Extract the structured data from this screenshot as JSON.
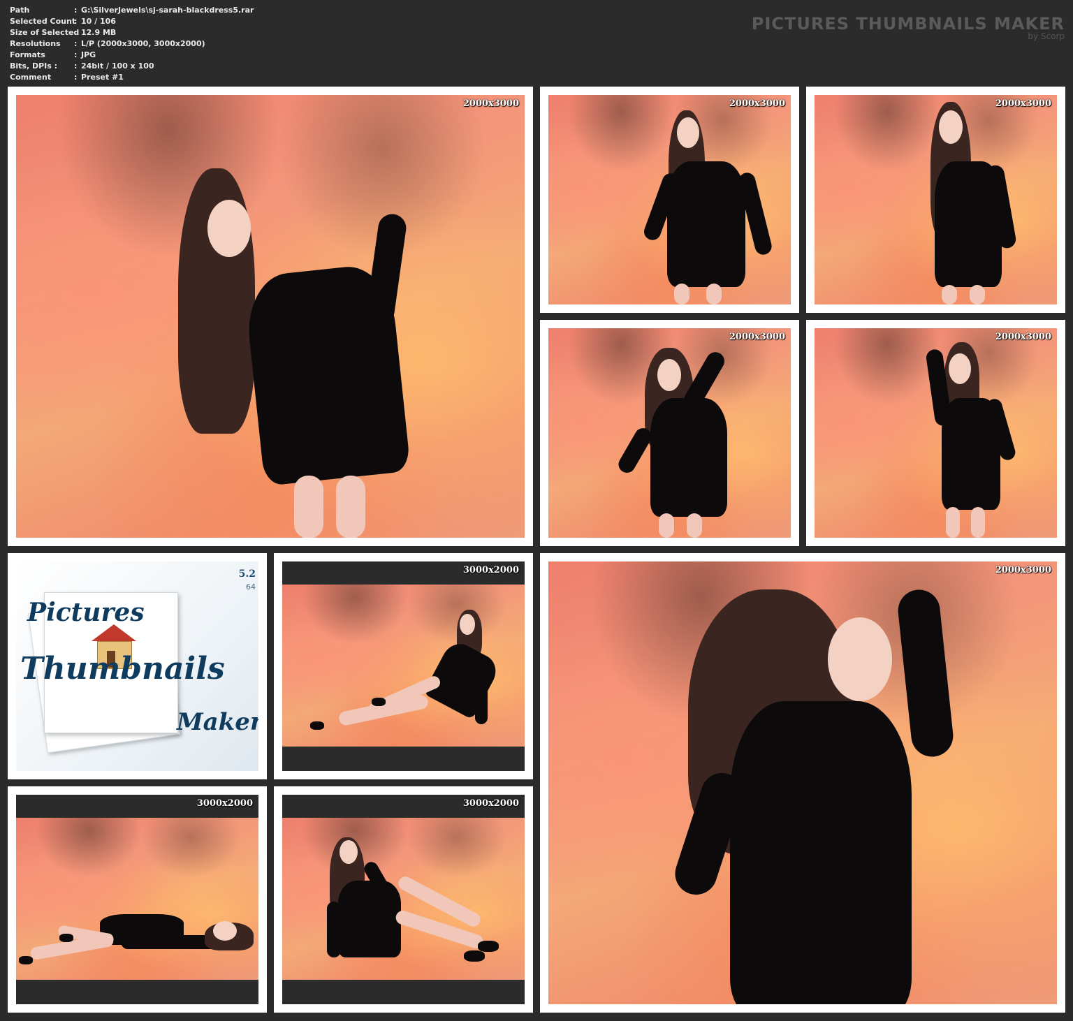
{
  "info": {
    "rows": [
      {
        "key": "Path",
        "sep": ":",
        "value": "G:\\SilverJewels\\sj-sarah-blackdress5.rar"
      },
      {
        "key": "Selected Count",
        "sep": ":",
        "value": "10 / 106"
      },
      {
        "key": "Size of Selected",
        "sep": ":",
        "value": "12.9 MB"
      },
      {
        "key": "Resolutions",
        "sep": ":",
        "value": "L/P (2000x3000, 3000x2000)"
      },
      {
        "key": "Formats",
        "sep": ":",
        "value": "JPG"
      },
      {
        "key": "Bits, DPIs :",
        "sep": ":",
        "value": "24bit / 100 x 100"
      },
      {
        "key": "Comment",
        "sep": ":",
        "value": "Preset #1"
      }
    ]
  },
  "brand": {
    "title": "PICTURES THUMBNAILS MAKER",
    "subtitle": "by Scorp"
  },
  "thumbnails": [
    {
      "res": "2000x3000"
    },
    {
      "res": "2000x3000"
    },
    {
      "res": "2000x3000"
    },
    {
      "res": "2000x3000"
    },
    {
      "res": "2000x3000"
    },
    {
      "res": "3000x2000"
    },
    {
      "res": "3000x2000"
    },
    {
      "res": "3000x2000"
    },
    {
      "res": "2000x3000"
    }
  ],
  "logo": {
    "word1": "Pictures",
    "word2": "Thumbnails",
    "word3": "Maker",
    "version": "5.2",
    "bits": "64"
  },
  "colors": {
    "background": "#2b2b2b",
    "tile": "#ffffff",
    "logo_ink": "#0f3c5e"
  }
}
